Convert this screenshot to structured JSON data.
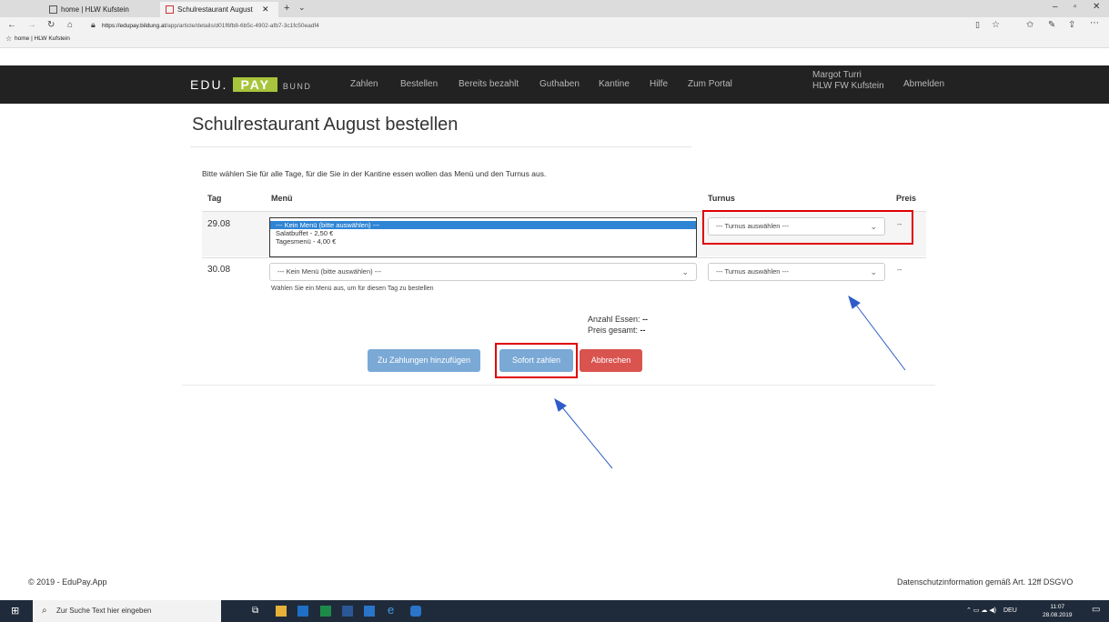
{
  "browser": {
    "tab1_label": "home | HLW Kufstein",
    "tab2_label": "Schulrestaurant August",
    "url_host": "https://edupay.bildung.at",
    "url_path": "/app/article/details/d01f6fb8-6b5c-4902-afb7-3c1fc50eadf4",
    "favorite_label": "home | HLW Kufstein"
  },
  "nav": {
    "logo_edu": "EDU.",
    "logo_pay": "PAY",
    "logo_bund": "BUND",
    "links": [
      "Zahlen",
      "Bestellen",
      "Bereits bezahlt",
      "Guthaben",
      "Kantine",
      "Hilfe",
      "Zum Portal"
    ],
    "user_name": "Margot Turri",
    "user_school": "HLW FW Kufstein",
    "logout": "Abmelden"
  },
  "page": {
    "title": "Schulrestaurant August bestellen",
    "instruction": "Bitte wählen Sie für alle Tage, für die Sie in der Kantine essen wollen das Menü und den Turnus aus.",
    "headers": {
      "day": "Tag",
      "menu": "Menü",
      "turnus": "Turnus",
      "price": "Preis"
    },
    "rows": [
      {
        "day": "29.08",
        "menu_options": [
          "--- Kein Menü (bitte auswählen) ---",
          "Salatbuffet - 2,50 €",
          "Tagesmenü - 4,00 €"
        ],
        "menu_selected": "--- Kein Menü (bitte auswählen) ---",
        "turnus": "--- Turnus auswählen ---",
        "price": "--"
      },
      {
        "day": "30.08",
        "menu_selected": "--- Kein Menü (bitte auswählen) ---",
        "hint": "Wählen Sie ein Menü aus, um für diesen Tag zu bestellen",
        "turnus": "--- Turnus auswählen ---",
        "price": "--"
      }
    ],
    "totals": {
      "count_label": "Anzahl Essen:",
      "count_value": "--",
      "sum_label": "Preis gesamt:",
      "sum_value": "--"
    },
    "buttons": {
      "add": "Zu Zahlungen hinzufügen",
      "pay": "Sofort zahlen",
      "cancel": "Abbrechen"
    }
  },
  "footer": {
    "copyright": "© 2019 - EduPay.App",
    "privacy": "Datenschutzinformation gemäß Art. 12ff DSGVO"
  },
  "taskbar": {
    "search_placeholder": "Zur Suche Text hier eingeben",
    "lang": "DEU",
    "time": "11:07",
    "date": "28.08.2019"
  },
  "colors": {
    "nav_bg": "#222222",
    "pay_green": "#a8c43c",
    "button_blue": "#7ba9d6",
    "button_red": "#d9534f",
    "highlight_red": "#e00000",
    "arrow_blue": "#2f5cc8"
  }
}
